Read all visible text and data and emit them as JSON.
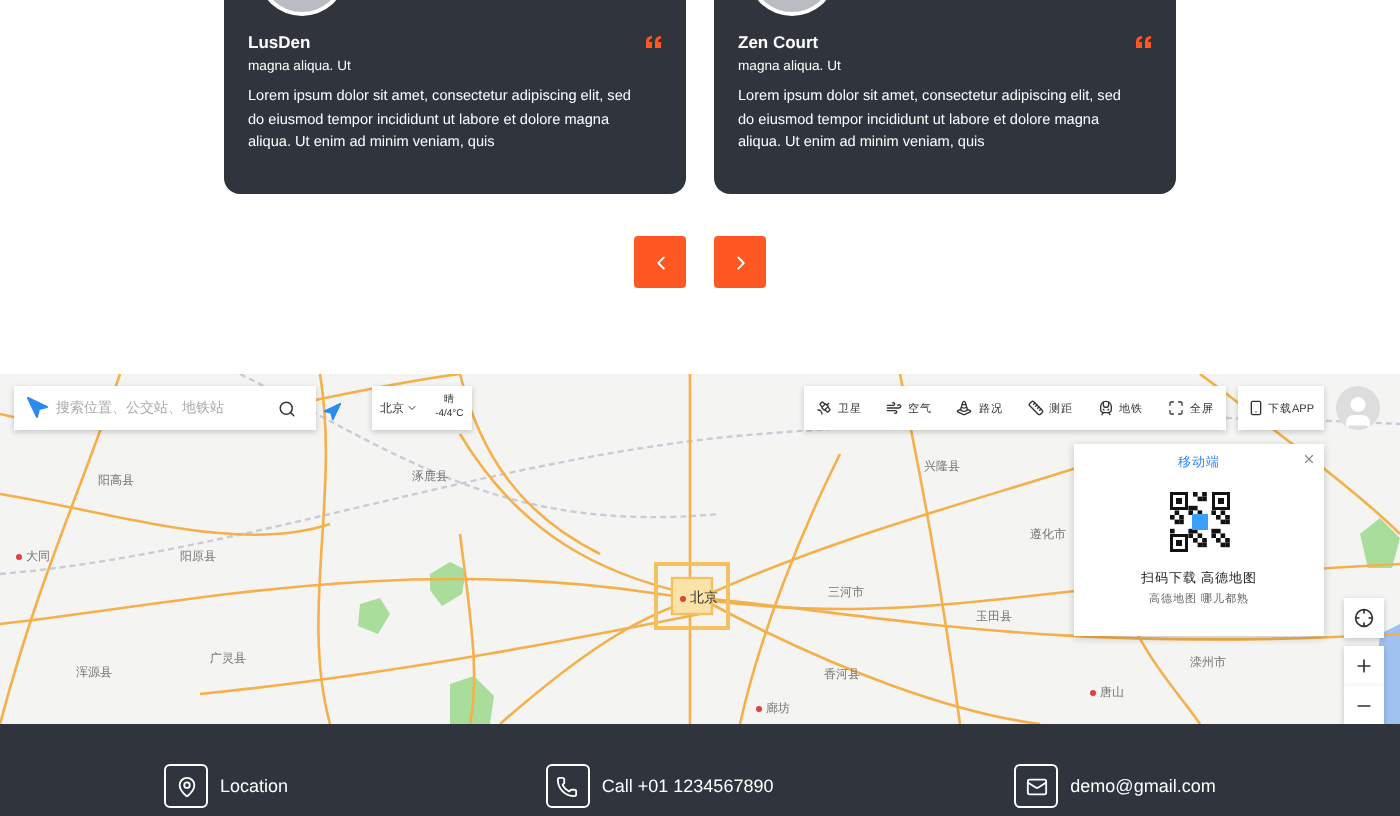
{
  "testimonials": [
    {
      "name": "LusDen",
      "role": "magna aliqua. Ut",
      "quote": "Lorem ipsum dolor sit amet, consectetur adipiscing elit, sed do eiusmod tempor incididunt ut labore et dolore magna aliqua. Ut enim ad minim veniam, quis"
    },
    {
      "name": "Zen Court",
      "role": "magna aliqua. Ut",
      "quote": "Lorem ipsum dolor sit amet, consectetur adipiscing elit, sed do eiusmod tempor incididunt ut labore et dolore magna aliqua. Ut enim ad minim veniam, quis"
    }
  ],
  "map": {
    "search": {
      "placeholder": "搜索位置、公交站、地铁站"
    },
    "city": "北京",
    "weather": {
      "condition": "晴",
      "temp": "-4/4°C"
    },
    "tools": [
      {
        "kind": "satellite",
        "label": "卫星"
      },
      {
        "kind": "air",
        "label": "空气"
      },
      {
        "kind": "traffic",
        "label": "路况"
      },
      {
        "kind": "measure",
        "label": "测距"
      },
      {
        "kind": "subway",
        "label": "地铁"
      },
      {
        "kind": "fullscreen",
        "label": "全屏"
      }
    ],
    "download": "下载APP",
    "popup": {
      "tab": "移动端",
      "title": "扫码下载 高德地图",
      "subtitle": "高德地图 哪儿都熟"
    },
    "places": [
      {
        "name": "阳高县",
        "kind": "county"
      },
      {
        "name": "大同",
        "kind": "city"
      },
      {
        "name": "阳原县",
        "kind": "county"
      },
      {
        "name": "浑源县",
        "kind": "county"
      },
      {
        "name": "广灵县",
        "kind": "county"
      },
      {
        "name": "涿鹿县",
        "kind": "county"
      },
      {
        "name": "北京",
        "kind": "capital"
      },
      {
        "name": "兴隆县",
        "kind": "county"
      },
      {
        "name": "遵化市",
        "kind": "county"
      },
      {
        "name": "三河市",
        "kind": "county"
      },
      {
        "name": "玉田县",
        "kind": "county"
      },
      {
        "name": "香河县",
        "kind": "county"
      },
      {
        "name": "滦州市",
        "kind": "county"
      },
      {
        "name": "唐山",
        "kind": "city"
      },
      {
        "name": "廊坊",
        "kind": "city"
      }
    ]
  },
  "footer": {
    "contacts": [
      {
        "kind": "location",
        "text": "Location"
      },
      {
        "kind": "phone",
        "text": "Call +01 1234567890"
      },
      {
        "kind": "email",
        "text": "demo@gmail.com"
      }
    ]
  }
}
